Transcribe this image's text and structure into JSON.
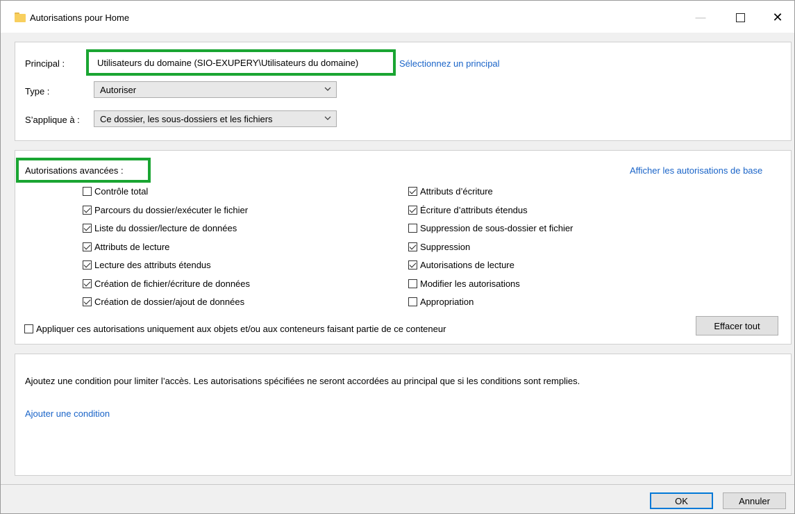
{
  "window": {
    "title": "Autorisations pour Home"
  },
  "principal": {
    "label": "Principal :",
    "value": "Utilisateurs du domaine (SIO-EXUPERY\\Utilisateurs du domaine)",
    "select_link": "Sélectionnez un principal"
  },
  "type": {
    "label": "Type :",
    "value": "Autoriser"
  },
  "applies_to": {
    "label": "S’applique à :",
    "value": "Ce dossier, les sous-dossiers et les fichiers"
  },
  "advanced": {
    "title": "Autorisations avancées :",
    "basic_link": "Afficher les autorisations de base",
    "left": [
      {
        "label": "Contrôle total",
        "checked": false
      },
      {
        "label": "Parcours du dossier/exécuter le fichier",
        "checked": true
      },
      {
        "label": "Liste du dossier/lecture de données",
        "checked": true
      },
      {
        "label": "Attributs de lecture",
        "checked": true
      },
      {
        "label": "Lecture des attributs étendus",
        "checked": true
      },
      {
        "label": "Création de fichier/écriture de données",
        "checked": true
      },
      {
        "label": "Création de dossier/ajout de données",
        "checked": true
      }
    ],
    "right": [
      {
        "label": "Attributs d’écriture",
        "checked": true
      },
      {
        "label": "Écriture d’attributs étendus",
        "checked": true
      },
      {
        "label": "Suppression de sous-dossier et fichier",
        "checked": false
      },
      {
        "label": "Suppression",
        "checked": true
      },
      {
        "label": "Autorisations de lecture",
        "checked": true
      },
      {
        "label": "Modifier les autorisations",
        "checked": false
      },
      {
        "label": "Appropriation",
        "checked": false
      }
    ],
    "apply_only_label": "Appliquer ces autorisations uniquement aux objets et/ou aux conteneurs faisant partie de ce conteneur",
    "apply_only_checked": false,
    "clear_all": "Effacer tout"
  },
  "condition": {
    "description": "Ajoutez une condition pour limiter l’accès. Les autorisations spécifiées ne seront accordées au principal que si les conditions sont remplies.",
    "add_link": "Ajouter une condition"
  },
  "footer": {
    "ok": "OK",
    "cancel": "Annuler"
  }
}
